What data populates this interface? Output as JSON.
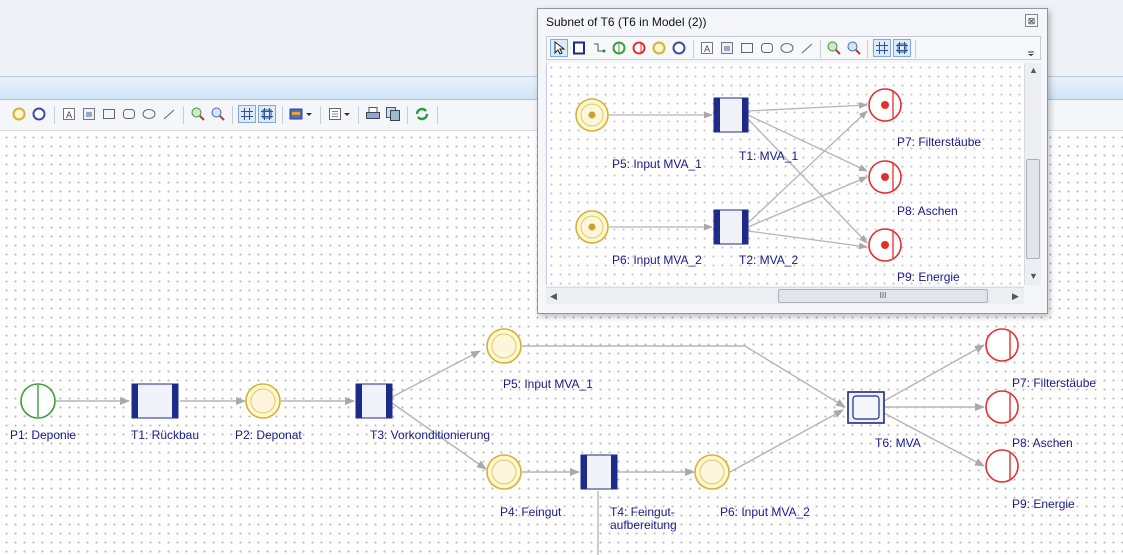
{
  "main_net": {
    "places": [
      {
        "id": "P1",
        "label": "P1: Deponie",
        "color": "#3aa03a"
      },
      {
        "id": "P2",
        "label": "P2: Deponat",
        "color": "#d4b13a"
      },
      {
        "id": "P4",
        "label": "P4: Feingut",
        "color": "#d4b13a"
      },
      {
        "id": "P5",
        "label": "P5: Input MVA_1",
        "color": "#d4b13a"
      },
      {
        "id": "P6",
        "label": "P6: Input MVA_2",
        "color": "#d4b13a"
      },
      {
        "id": "P7",
        "label": "P7: Filterstäube",
        "color": "#e23030"
      },
      {
        "id": "P8",
        "label": "P8: Aschen",
        "color": "#e23030"
      },
      {
        "id": "P9",
        "label": "P9: Energie",
        "color": "#e23030"
      }
    ],
    "transitions": [
      {
        "id": "T1",
        "label": "T1: Rückbau"
      },
      {
        "id": "T3",
        "label": "T3: Vorkonditionierung"
      },
      {
        "id": "T4",
        "label_line1": "T4: Feingut-",
        "label_line2": "aufbereitung"
      },
      {
        "id": "T6",
        "label": "T6: MVA"
      }
    ]
  },
  "subnet_window": {
    "title": "Subnet of T6 (T6 in Model (2))",
    "close_glyph": "⊠",
    "scroll_thumb_glyph": "III",
    "places": [
      {
        "id": "P5",
        "label": "P5: Input MVA_1"
      },
      {
        "id": "P6",
        "label": "P6: Input MVA_2"
      },
      {
        "id": "P7",
        "label": "P7: Filterstäube"
      },
      {
        "id": "P8",
        "label": "P8: Aschen"
      },
      {
        "id": "P9",
        "label": "P9: Energie"
      }
    ],
    "transitions": [
      {
        "id": "T1",
        "label": "T1: MVA_1"
      },
      {
        "id": "T2",
        "label": "T2: MVA_2"
      }
    ]
  },
  "colors": {
    "transition": "#1e2a8a",
    "place_input": "#d4b13a",
    "place_output": "#e23030",
    "place_source": "#3aa03a",
    "label_text": "#1a1a8c"
  }
}
